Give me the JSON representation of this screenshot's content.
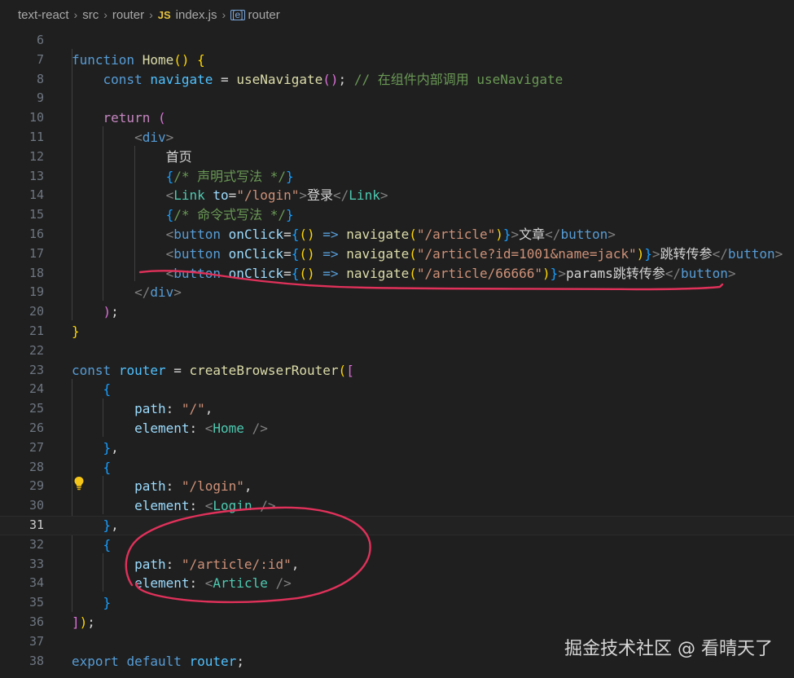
{
  "breadcrumb": {
    "items": [
      "text-react",
      "src",
      "router",
      "index.js",
      "router"
    ],
    "file_icon_text": "JS"
  },
  "editor": {
    "current_line": 31,
    "lines": [
      {
        "n": 6,
        "tokens": []
      },
      {
        "n": 7,
        "tokens": [
          [
            "kw",
            "function"
          ],
          [
            "pun",
            " "
          ],
          [
            "fn",
            "Home"
          ],
          [
            "b1",
            "()"
          ],
          [
            "pun",
            " "
          ],
          [
            "b1",
            "{"
          ]
        ]
      },
      {
        "n": 8,
        "tokens": [
          [
            "pun",
            "    "
          ],
          [
            "kw",
            "const"
          ],
          [
            "pun",
            " "
          ],
          [
            "cst",
            "navigate"
          ],
          [
            "pun",
            " = "
          ],
          [
            "fn",
            "useNavigate"
          ],
          [
            "b2",
            "()"
          ],
          [
            "pun",
            "; "
          ],
          [
            "cmt",
            "// 在组件内部调用 useNavigate"
          ]
        ]
      },
      {
        "n": 9,
        "tokens": []
      },
      {
        "n": 10,
        "tokens": [
          [
            "pun",
            "    "
          ],
          [
            "ctl",
            "return"
          ],
          [
            "pun",
            " "
          ],
          [
            "b2",
            "("
          ]
        ]
      },
      {
        "n": 11,
        "tokens": [
          [
            "pun",
            "        "
          ],
          [
            "tagb",
            "<"
          ],
          [
            "htag",
            "div"
          ],
          [
            "tagb",
            ">"
          ]
        ]
      },
      {
        "n": 12,
        "tokens": [
          [
            "pun",
            "            "
          ],
          [
            "txt",
            "首页"
          ]
        ]
      },
      {
        "n": 13,
        "tokens": [
          [
            "pun",
            "            "
          ],
          [
            "b3",
            "{"
          ],
          [
            "cmt",
            "/* 声明式写法 */"
          ],
          [
            "b3",
            "}"
          ]
        ]
      },
      {
        "n": 14,
        "tokens": [
          [
            "pun",
            "            "
          ],
          [
            "tagb",
            "<"
          ],
          [
            "tag",
            "Link"
          ],
          [
            "pun",
            " "
          ],
          [
            "attr",
            "to"
          ],
          [
            "pun",
            "="
          ],
          [
            "str",
            "\"/login\""
          ],
          [
            "tagb",
            ">"
          ],
          [
            "txt",
            "登录"
          ],
          [
            "tagb",
            "</"
          ],
          [
            "tag",
            "Link"
          ],
          [
            "tagb",
            ">"
          ]
        ]
      },
      {
        "n": 15,
        "tokens": [
          [
            "pun",
            "            "
          ],
          [
            "b3",
            "{"
          ],
          [
            "cmt",
            "/* 命令式写法 */"
          ],
          [
            "b3",
            "}"
          ]
        ]
      },
      {
        "n": 16,
        "tokens": [
          [
            "pun",
            "            "
          ],
          [
            "tagb",
            "<"
          ],
          [
            "htag",
            "button"
          ],
          [
            "pun",
            " "
          ],
          [
            "attr",
            "onClick"
          ],
          [
            "pun",
            "="
          ],
          [
            "b3",
            "{"
          ],
          [
            "b1",
            "()"
          ],
          [
            "pun",
            " "
          ],
          [
            "kw",
            "=>"
          ],
          [
            "pun",
            " "
          ],
          [
            "fn",
            "navigate"
          ],
          [
            "b1",
            "("
          ],
          [
            "str",
            "\"/article\""
          ],
          [
            "b1",
            ")"
          ],
          [
            "b3",
            "}"
          ],
          [
            "tagb",
            ">"
          ],
          [
            "txt",
            "文章"
          ],
          [
            "tagb",
            "</"
          ],
          [
            "htag",
            "button"
          ],
          [
            "tagb",
            ">"
          ]
        ]
      },
      {
        "n": 17,
        "tokens": [
          [
            "pun",
            "            "
          ],
          [
            "tagb",
            "<"
          ],
          [
            "htag",
            "button"
          ],
          [
            "pun",
            " "
          ],
          [
            "attr",
            "onClick"
          ],
          [
            "pun",
            "="
          ],
          [
            "b3",
            "{"
          ],
          [
            "b1",
            "()"
          ],
          [
            "pun",
            " "
          ],
          [
            "kw",
            "=>"
          ],
          [
            "pun",
            " "
          ],
          [
            "fn",
            "navigate"
          ],
          [
            "b1",
            "("
          ],
          [
            "str",
            "\"/article?id=1001&name=jack\""
          ],
          [
            "b1",
            ")"
          ],
          [
            "b3",
            "}"
          ],
          [
            "tagb",
            ">"
          ],
          [
            "txt",
            "跳转传参"
          ],
          [
            "tagb",
            "</"
          ],
          [
            "htag",
            "button"
          ],
          [
            "tagb",
            ">"
          ]
        ]
      },
      {
        "n": 18,
        "tokens": [
          [
            "pun",
            "            "
          ],
          [
            "tagb",
            "<"
          ],
          [
            "htag",
            "button"
          ],
          [
            "pun",
            " "
          ],
          [
            "attr",
            "onClick"
          ],
          [
            "pun",
            "="
          ],
          [
            "b3",
            "{"
          ],
          [
            "b1",
            "()"
          ],
          [
            "pun",
            " "
          ],
          [
            "kw",
            "=>"
          ],
          [
            "pun",
            " "
          ],
          [
            "fn",
            "navigate"
          ],
          [
            "b1",
            "("
          ],
          [
            "str",
            "\"/article/66666\""
          ],
          [
            "b1",
            ")"
          ],
          [
            "b3",
            "}"
          ],
          [
            "tagb",
            ">"
          ],
          [
            "txt",
            "params跳转传参"
          ],
          [
            "tagb",
            "</"
          ],
          [
            "htag",
            "button"
          ],
          [
            "tagb",
            ">"
          ]
        ]
      },
      {
        "n": 19,
        "tokens": [
          [
            "pun",
            "        "
          ],
          [
            "tagb",
            "</"
          ],
          [
            "htag",
            "div"
          ],
          [
            "tagb",
            ">"
          ]
        ]
      },
      {
        "n": 20,
        "tokens": [
          [
            "pun",
            "    "
          ],
          [
            "b2",
            ")"
          ],
          [
            "pun",
            ";"
          ]
        ]
      },
      {
        "n": 21,
        "tokens": [
          [
            "b1",
            "}"
          ]
        ]
      },
      {
        "n": 22,
        "tokens": []
      },
      {
        "n": 23,
        "tokens": [
          [
            "kw",
            "const"
          ],
          [
            "pun",
            " "
          ],
          [
            "cst",
            "router"
          ],
          [
            "pun",
            " = "
          ],
          [
            "fn",
            "createBrowserRouter"
          ],
          [
            "b1",
            "("
          ],
          [
            "b2",
            "["
          ]
        ]
      },
      {
        "n": 24,
        "tokens": [
          [
            "pun",
            "    "
          ],
          [
            "b3",
            "{"
          ]
        ]
      },
      {
        "n": 25,
        "tokens": [
          [
            "pun",
            "        "
          ],
          [
            "var",
            "path"
          ],
          [
            "pun",
            ": "
          ],
          [
            "str",
            "\"/\""
          ],
          [
            "pun",
            ","
          ]
        ]
      },
      {
        "n": 26,
        "tokens": [
          [
            "pun",
            "        "
          ],
          [
            "var",
            "element"
          ],
          [
            "pun",
            ": "
          ],
          [
            "tagb",
            "<"
          ],
          [
            "tag",
            "Home"
          ],
          [
            "pun",
            " "
          ],
          [
            "tagb",
            "/>"
          ]
        ]
      },
      {
        "n": 27,
        "tokens": [
          [
            "pun",
            "    "
          ],
          [
            "b3",
            "}"
          ],
          [
            "pun",
            ","
          ]
        ]
      },
      {
        "n": 28,
        "tokens": [
          [
            "pun",
            "    "
          ],
          [
            "b3",
            "{"
          ]
        ]
      },
      {
        "n": 29,
        "tokens": [
          [
            "pun",
            "        "
          ],
          [
            "var",
            "path"
          ],
          [
            "pun",
            ": "
          ],
          [
            "str",
            "\"/login\""
          ],
          [
            "pun",
            ","
          ]
        ]
      },
      {
        "n": 30,
        "tokens": [
          [
            "pun",
            "        "
          ],
          [
            "var",
            "element"
          ],
          [
            "pun",
            ": "
          ],
          [
            "tagb",
            "<"
          ],
          [
            "tag",
            "Login"
          ],
          [
            "pun",
            " "
          ],
          [
            "tagb",
            "/>"
          ]
        ]
      },
      {
        "n": 31,
        "tokens": [
          [
            "pun",
            "    "
          ],
          [
            "b3",
            "}"
          ],
          [
            "pun",
            ","
          ]
        ]
      },
      {
        "n": 32,
        "tokens": [
          [
            "pun",
            "    "
          ],
          [
            "b3",
            "{"
          ]
        ]
      },
      {
        "n": 33,
        "tokens": [
          [
            "pun",
            "        "
          ],
          [
            "var",
            "path"
          ],
          [
            "pun",
            ": "
          ],
          [
            "str",
            "\"/article/:id\""
          ],
          [
            "pun",
            ","
          ]
        ]
      },
      {
        "n": 34,
        "tokens": [
          [
            "pun",
            "        "
          ],
          [
            "var",
            "element"
          ],
          [
            "pun",
            ": "
          ],
          [
            "tagb",
            "<"
          ],
          [
            "tag",
            "Article"
          ],
          [
            "pun",
            " "
          ],
          [
            "tagb",
            "/>"
          ]
        ]
      },
      {
        "n": 35,
        "tokens": [
          [
            "pun",
            "    "
          ],
          [
            "b3",
            "}"
          ]
        ]
      },
      {
        "n": 36,
        "tokens": [
          [
            "b2",
            "]"
          ],
          [
            "b1",
            ")"
          ],
          [
            "pun",
            ";"
          ]
        ]
      },
      {
        "n": 37,
        "tokens": []
      },
      {
        "n": 38,
        "tokens": [
          [
            "kw",
            "export"
          ],
          [
            "pun",
            " "
          ],
          [
            "kw",
            "default"
          ],
          [
            "pun",
            " "
          ],
          [
            "cst",
            "router"
          ],
          [
            "pun",
            ";"
          ]
        ]
      }
    ]
  },
  "watermark": "掘金技术社区 @ 看晴天了",
  "colors": {
    "background": "#1f1f1f",
    "annotation": "#e0315a",
    "lightbulb": "#f5c518"
  },
  "icons": [
    "javascript-file-icon",
    "symbol-variable-icon",
    "lightbulb-icon",
    "chevron-right-icon"
  ]
}
